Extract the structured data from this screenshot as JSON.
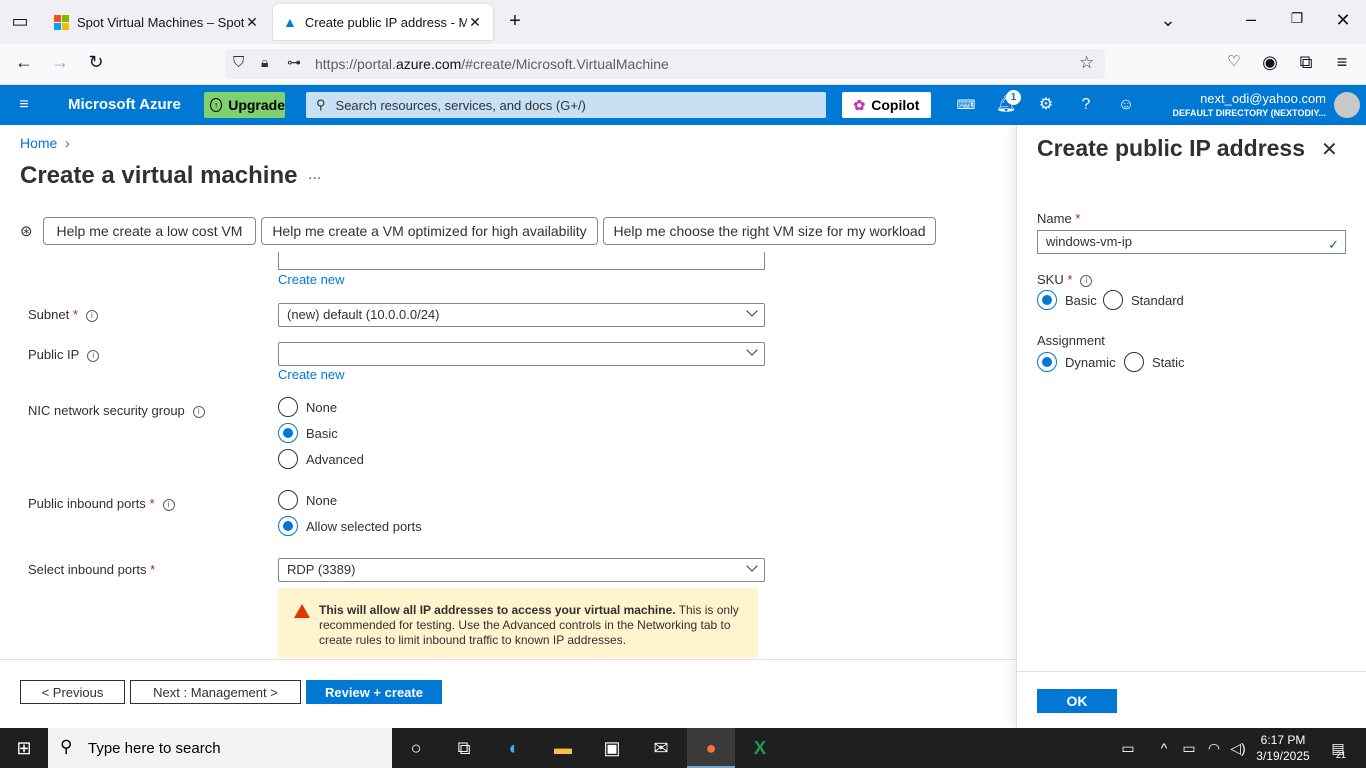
{
  "browser": {
    "tabs": [
      {
        "title": "Spot Virtual Machines – Spot Pr",
        "active": false
      },
      {
        "title": "Create public IP address - Micro",
        "active": true
      }
    ],
    "url_prefix": "https://portal.",
    "url_domain": "azure.com",
    "url_suffix": "/#create/Microsoft.VirtualMachine"
  },
  "azure_header": {
    "brand": "Microsoft Azure",
    "upgrade": "Upgrade",
    "search_placeholder": "Search resources, services, and docs (G+/)",
    "copilot": "Copilot",
    "notifications_count": "1",
    "user_email": "next_odi@yahoo.com",
    "user_directory": "DEFAULT DIRECTORY (NEXTODIY..."
  },
  "main": {
    "breadcrumb": "Home",
    "title": "Create a virtual machine",
    "more": "...",
    "chips": [
      "Help me create a low cost VM",
      "Help me create a VM optimized for high availability",
      "Help me choose the right VM size for my workload"
    ],
    "create_new_1": "Create new",
    "subnet_label": "Subnet",
    "subnet_value": "(new) default (10.0.0.0/24)",
    "public_ip_label": "Public IP",
    "public_ip_value": "",
    "create_new_2": "Create new",
    "nic_label": "NIC network security group",
    "nic_options": [
      "None",
      "Basic",
      "Advanced"
    ],
    "nic_selected": "Basic",
    "inbound_label": "Public inbound ports",
    "inbound_options": [
      "None",
      "Allow selected ports"
    ],
    "select_ports_label": "Select inbound ports",
    "select_ports_value": "RDP (3389)",
    "warning_bold": "This will allow all IP addresses to access your virtual machine.",
    "warning_text": " This is only recommended for testing.  Use the Advanced controls in the Networking tab to create rules to limit inbound traffic to known IP addresses."
  },
  "footer": {
    "previous": "< Previous",
    "next": "Next : Management >",
    "review": "Review + create"
  },
  "blade": {
    "title": "Create public IP address",
    "name_label": "Name",
    "name_value": "windows-vm-ip",
    "sku_label": "SKU",
    "sku_options": [
      "Basic",
      "Standard"
    ],
    "assignment_label": "Assignment",
    "assignment_options": [
      "Dynamic",
      "Static"
    ],
    "ok": "OK"
  },
  "taskbar": {
    "search_placeholder": "Type here to search",
    "time": "6:17 PM",
    "date": "3/19/2025",
    "notif_count": "21"
  },
  "colors": {
    "azure_blue": "#0078d4",
    "upgrade_green": "#7fd16f",
    "warning_bg": "#fff4ce"
  }
}
